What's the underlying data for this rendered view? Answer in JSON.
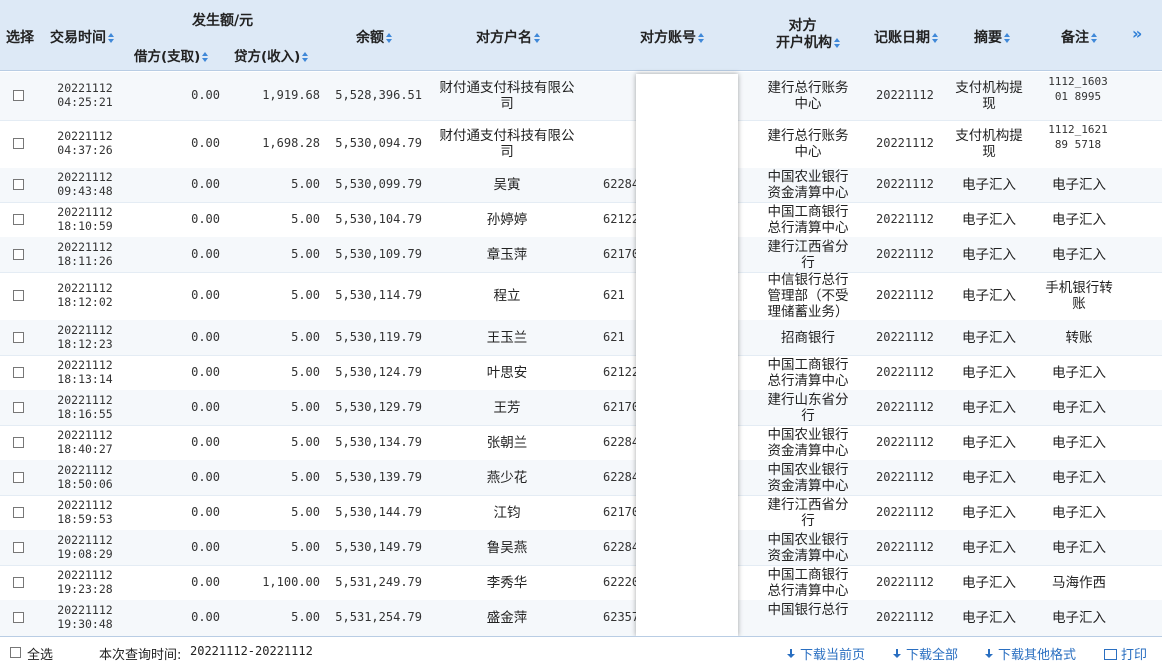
{
  "header": {
    "select": "选择",
    "time": "交易时间",
    "amount_group": "发生额/元",
    "debit": "借方(支取)",
    "credit": "贷方(收入)",
    "balance": "余额",
    "name": "对方户名",
    "account": "对方账号",
    "org_line1": "对方",
    "org_line2": "开户机构",
    "date": "记账日期",
    "summary": "摘要",
    "remark": "备注",
    "more": "»"
  },
  "rows": [
    {
      "date": "20221112",
      "time": "04:25:21",
      "debit": "0.00",
      "credit": "1,919.68",
      "balance": "5,528,396.51",
      "name": "财付通支付科技有限公司",
      "acct": "",
      "org": "建行总行账务中心",
      "book": "20221112",
      "summary": "支付机构提现",
      "remark": "1112_160301 8995"
    },
    {
      "date": "20221112",
      "time": "04:37:26",
      "debit": "0.00",
      "credit": "1,698.28",
      "balance": "5,530,094.79",
      "name": "财付通支付科技有限公司",
      "acct": "",
      "org": "建行总行账务中心",
      "book": "20221112",
      "summary": "支付机构提现",
      "remark": "1112_162189 5718"
    },
    {
      "date": "20221112",
      "time": "09:43:48",
      "debit": "0.00",
      "credit": "5.00",
      "balance": "5,530,099.79",
      "name": "吴寅",
      "acct": "62284",
      "org": "中国农业银行资金清算中心",
      "book": "20221112",
      "summary": "电子汇入",
      "remark": "电子汇入"
    },
    {
      "date": "20221112",
      "time": "18:10:59",
      "debit": "0.00",
      "credit": "5.00",
      "balance": "5,530,104.79",
      "name": "孙婷婷",
      "acct": "62122",
      "org": "中国工商银行总行清算中心",
      "book": "20221112",
      "summary": "电子汇入",
      "remark": "电子汇入"
    },
    {
      "date": "20221112",
      "time": "18:11:26",
      "debit": "0.00",
      "credit": "5.00",
      "balance": "5,530,109.79",
      "name": "章玉萍",
      "acct": "62170",
      "org": "建行江西省分行",
      "book": "20221112",
      "summary": "电子汇入",
      "remark": "电子汇入"
    },
    {
      "date": "20221112",
      "time": "18:12:02",
      "debit": "0.00",
      "credit": "5.00",
      "balance": "5,530,114.79",
      "name": "程立",
      "acct": "621",
      "org": "中信银行总行管理部（不受理储蓄业务）",
      "book": "20221112",
      "summary": "电子汇入",
      "remark": "手机银行转账"
    },
    {
      "date": "20221112",
      "time": "18:12:23",
      "debit": "0.00",
      "credit": "5.00",
      "balance": "5,530,119.79",
      "name": "王玉兰",
      "acct": "621",
      "org": "招商银行",
      "book": "20221112",
      "summary": "电子汇入",
      "remark": "转账"
    },
    {
      "date": "20221112",
      "time": "18:13:14",
      "debit": "0.00",
      "credit": "5.00",
      "balance": "5,530,124.79",
      "name": "叶思安",
      "acct": "62122",
      "org": "中国工商银行总行清算中心",
      "book": "20221112",
      "summary": "电子汇入",
      "remark": "电子汇入"
    },
    {
      "date": "20221112",
      "time": "18:16:55",
      "debit": "0.00",
      "credit": "5.00",
      "balance": "5,530,129.79",
      "name": "王芳",
      "acct": "62170",
      "org": "建行山东省分行",
      "book": "20221112",
      "summary": "电子汇入",
      "remark": "电子汇入"
    },
    {
      "date": "20221112",
      "time": "18:40:27",
      "debit": "0.00",
      "credit": "5.00",
      "balance": "5,530,134.79",
      "name": "张朝兰",
      "acct": "62284",
      "org": "中国农业银行资金清算中心",
      "book": "20221112",
      "summary": "电子汇入",
      "remark": "电子汇入"
    },
    {
      "date": "20221112",
      "time": "18:50:06",
      "debit": "0.00",
      "credit": "5.00",
      "balance": "5,530,139.79",
      "name": "燕少花",
      "acct": "62284",
      "org": "中国农业银行资金清算中心",
      "book": "20221112",
      "summary": "电子汇入",
      "remark": "电子汇入"
    },
    {
      "date": "20221112",
      "time": "18:59:53",
      "debit": "0.00",
      "credit": "5.00",
      "balance": "5,530,144.79",
      "name": "江钧",
      "acct": "62170",
      "org": "建行江西省分行",
      "book": "20221112",
      "summary": "电子汇入",
      "remark": "电子汇入"
    },
    {
      "date": "20221112",
      "time": "19:08:29",
      "debit": "0.00",
      "credit": "5.00",
      "balance": "5,530,149.79",
      "name": "鲁吴燕",
      "acct": "62284",
      "org": "中国农业银行资金清算中心",
      "book": "20221112",
      "summary": "电子汇入",
      "remark": "电子汇入"
    },
    {
      "date": "20221112",
      "time": "19:23:28",
      "debit": "0.00",
      "credit": "1,100.00",
      "balance": "5,531,249.79",
      "name": "李秀华",
      "acct": "62220",
      "org": "中国工商银行总行清算中心",
      "book": "20221112",
      "summary": "电子汇入",
      "remark": "马海作西"
    },
    {
      "date": "20221112",
      "time": "19:30:48",
      "debit": "0.00",
      "credit": "5.00",
      "balance": "5,531,254.79",
      "name": "盛金萍",
      "acct": "62357",
      "org": "中国银行总行",
      "book": "20221112",
      "summary": "电子汇入",
      "remark": "电子汇入"
    }
  ],
  "footer": {
    "select_all": "全选",
    "query_time_label": "本次查询时间:",
    "query_time_value": "20221112-20221112",
    "download_page": "下载当前页",
    "download_all": "下载全部",
    "download_other": "下载其他格式",
    "print": "打印"
  }
}
